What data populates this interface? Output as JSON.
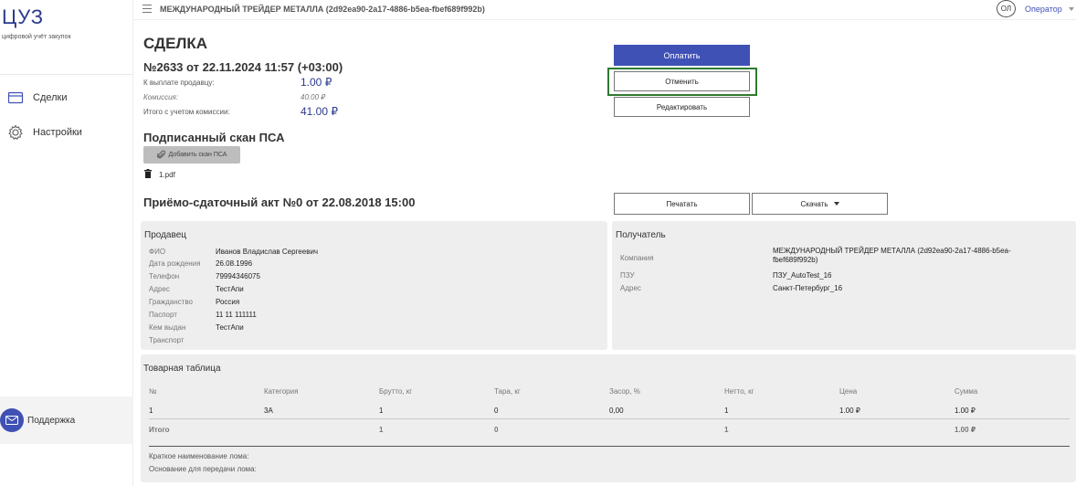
{
  "sidebar": {
    "logo": "ЦУЗ",
    "logo_sub": "цифровой учёт закупок",
    "items": [
      {
        "label": "Сделки",
        "icon": "card-icon"
      },
      {
        "label": "Настройки",
        "icon": "gear-icon"
      }
    ],
    "support_label": "Поддержка"
  },
  "header": {
    "title": "МЕЖДУНАРОДНЫЙ ТРЕЙДЕР МЕТАЛЛА (2d92ea90-2a17-4886-b5ea-fbef689f992b)",
    "avatar_initials": "ОЛ",
    "operator_label": "Оператор"
  },
  "deal": {
    "heading": "СДЕЛКА",
    "number_line": "№2633 от 22.11.2024 11:57 (+03:00)",
    "payout_label": "К выплате продавцу:",
    "payout_value": "1.00 ₽",
    "commission_label": "Комиссия:",
    "commission_value": "40.00 ₽",
    "total_label": "Итого с учетом комиссии:",
    "total_value": "41.00 ₽"
  },
  "actions": {
    "pay_label": "Оплатить",
    "cancel_label": "Отменить",
    "edit_label": "Редактировать"
  },
  "scan": {
    "heading": "Подписанный скан ПСА",
    "add_button": "Добавить скан ПСА",
    "file_name": "1.pdf"
  },
  "act": {
    "heading": "Приёмо-сдаточный акт №0 от 22.08.2018 15:00",
    "print_label": "Печатать",
    "download_label": "Скачать"
  },
  "seller": {
    "title": "Продавец",
    "rows": [
      {
        "k": "ФИО",
        "v": "Иванов Владислав Сергеевич"
      },
      {
        "k": "Дата рождения",
        "v": "26.08.1996"
      },
      {
        "k": "Телефон",
        "v": "79994346075"
      },
      {
        "k": "Адрес",
        "v": "ТестАпи"
      },
      {
        "k": "Гражданство",
        "v": "Россия"
      },
      {
        "k": "Паспорт",
        "v": "11 11 111111"
      },
      {
        "k": "Кем выдан",
        "v": "ТестАпи"
      },
      {
        "k": "Транспорт",
        "v": ""
      }
    ]
  },
  "recipient": {
    "title": "Получатель",
    "company_label": "Компания",
    "company_value_line1": "МЕЖДУНАРОДНЫЙ ТРЕЙДЕР МЕТАЛЛА (2d92ea90-2a17-4886-b5ea-",
    "company_value_line2": "fbef689f992b)",
    "pzu_label": "ПЗУ",
    "pzu_value": "ПЗУ_AutoTest_16",
    "address_label": "Адрес",
    "address_value": "Санкт-Петербург_16"
  },
  "goods": {
    "title": "Товарная таблица",
    "columns": [
      "№",
      "Категория",
      "Брутто, кг",
      "Тара, кг",
      "Засор, %",
      "Нетто, кг",
      "Цена",
      "Сумма"
    ],
    "rows": [
      [
        "1",
        "3А",
        "1",
        "0",
        "0,00",
        "1",
        "1.00 ₽",
        "1.00 ₽"
      ]
    ],
    "total": [
      "Итого",
      "",
      "1",
      "0",
      "",
      "1",
      "",
      "1.00 ₽"
    ],
    "note_short_name": "Краткое наименование лома:",
    "note_basis": "Основание для передачи лома:"
  }
}
